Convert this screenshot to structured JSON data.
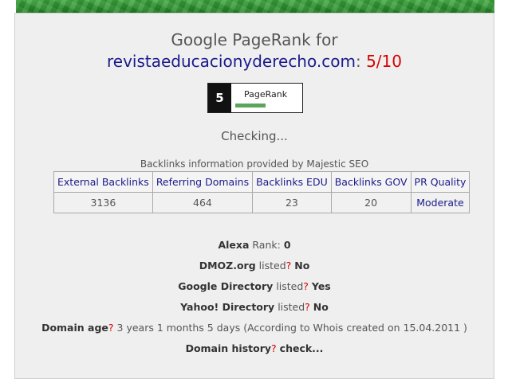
{
  "header": {
    "title_prefix": "Google PageRank for",
    "domain": "revistaeducacionyderecho.com",
    "colon": ":",
    "score": "5/10"
  },
  "pagerank_widget": {
    "value": "5",
    "label": "PageRank",
    "fill_fraction": 0.5,
    "bar_color": "#5aa55a"
  },
  "status": {
    "checking": "Checking..."
  },
  "backlinks": {
    "caption": "Backlinks information provided by Majestic SEO",
    "columns": [
      "External Backlinks",
      "Referring Domains",
      "Backlinks EDU",
      "Backlinks GOV",
      "PR Quality"
    ],
    "values": [
      "3136",
      "464",
      "23",
      "20",
      "Moderate"
    ]
  },
  "info": {
    "alexa_label": "Alexa",
    "alexa_rest": "Rank:",
    "alexa_value": "0",
    "dmoz_label": "DMOZ.org",
    "dmoz_rest": "listed",
    "dmoz_q": "?",
    "dmoz_value": "No",
    "gdir_label": "Google Directory",
    "gdir_rest": "listed",
    "gdir_q": "?",
    "gdir_value": "Yes",
    "yahoo_label": "Yahoo! Directory",
    "yahoo_rest": "listed",
    "yahoo_q": "?",
    "yahoo_value": "No",
    "age_label": "Domain age",
    "age_q": "?",
    "age_value": "3 years 1 months 5 days (According to Whois created on 15.04.2011 )",
    "history_label": "Domain history",
    "history_q": "?",
    "history_value": "check..."
  },
  "colors": {
    "link": "#1a1a8c",
    "accent_red": "#d90000",
    "banner_green": "#2e9a33"
  }
}
